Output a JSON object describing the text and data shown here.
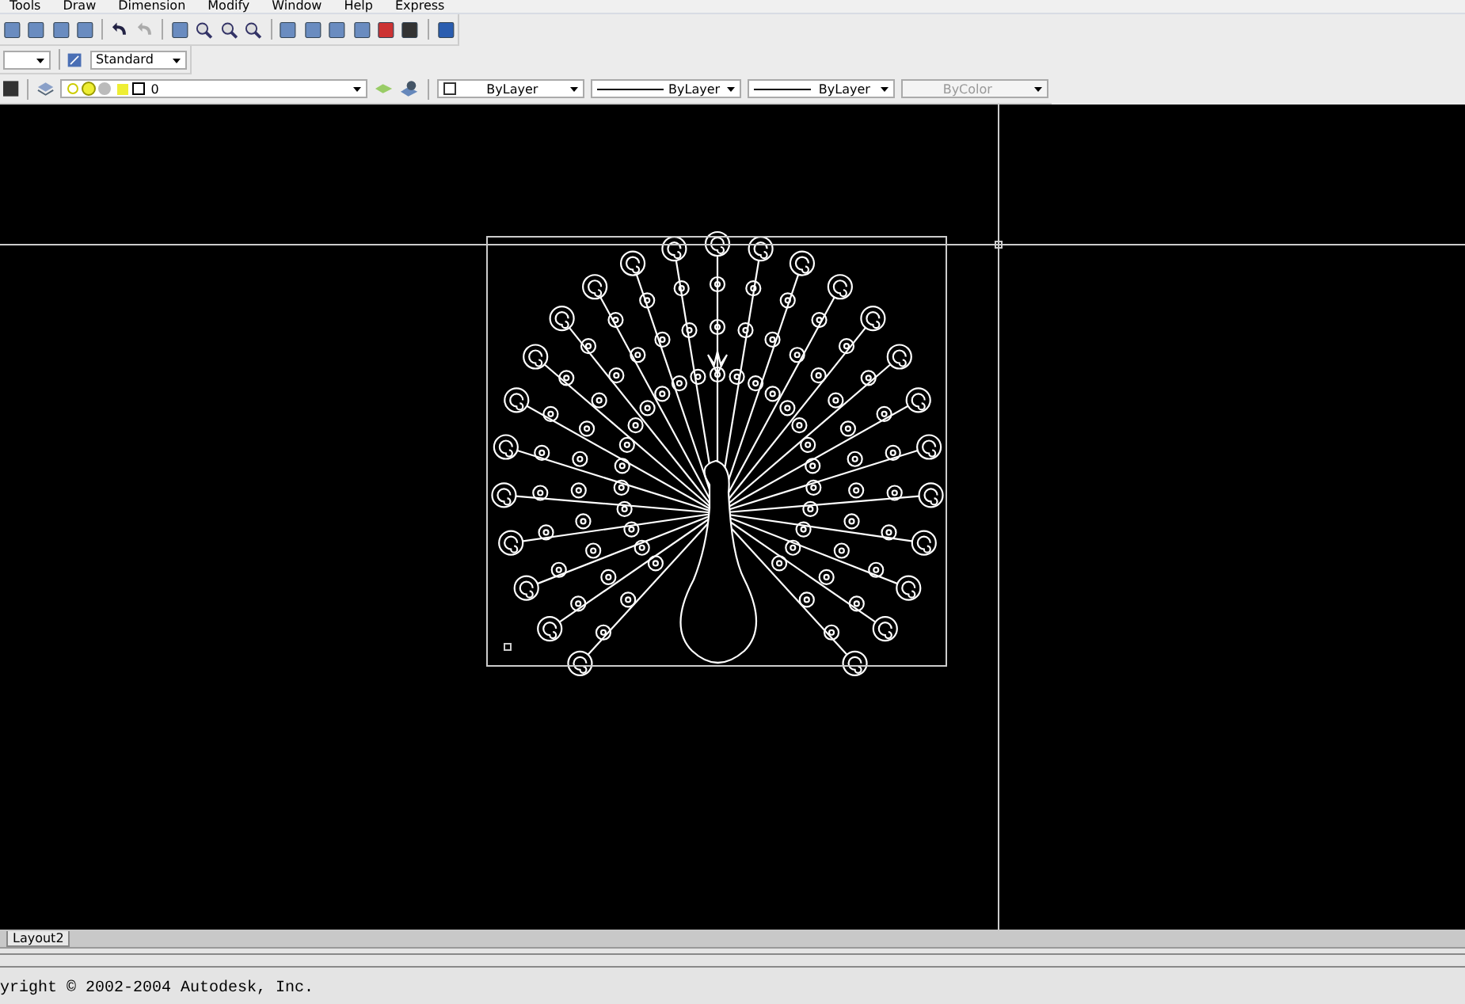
{
  "menu_bar": {
    "items": [
      "Tools",
      "Draw",
      "Dimension",
      "Modify",
      "Window",
      "Help",
      "Express"
    ]
  },
  "styles_toolbar": {
    "text_style": "Standard"
  },
  "layers_toolbar": {
    "layer": "0"
  },
  "properties_toolbar": [
    {
      "kind": "color",
      "value": "ByLayer",
      "disabled": false
    },
    {
      "kind": "linetype",
      "value": "ByLayer",
      "disabled": false
    },
    {
      "kind": "lineweight",
      "value": "ByLayer",
      "disabled": false
    },
    {
      "kind": "plotstyle",
      "value": "ByColor",
      "disabled": true
    }
  ],
  "layout_tabs": [
    {
      "label": "Layout2",
      "selected": false
    }
  ],
  "command_line": {
    "lines": [
      "yright © 2002-2004 Autodesk, Inc."
    ]
  }
}
